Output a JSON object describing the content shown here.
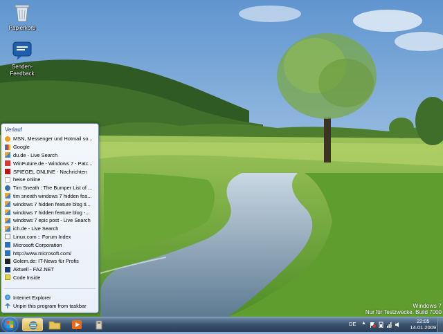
{
  "desktop": {
    "icons": [
      {
        "label": "Papierkorb",
        "icon": "recycle-bin-icon"
      },
      {
        "label": "Senden-Feedback",
        "icon": "feedback-icon"
      }
    ]
  },
  "jumplist": {
    "header": "Verlauf",
    "history": [
      {
        "label": "MSN, Messenger und Hotmail so...",
        "icon": "msn-icon"
      },
      {
        "label": "Google",
        "icon": "google-icon"
      },
      {
        "label": "du.de - Live Search",
        "icon": "live-search-icon"
      },
      {
        "label": "WinFuture.de - Windows 7 - Patc...",
        "icon": "winfuture-icon"
      },
      {
        "label": "SPIEGEL ONLINE - Nachrichten",
        "icon": "spiegel-icon"
      },
      {
        "label": "heise online",
        "icon": "heise-icon"
      },
      {
        "label": "Tim Sneath : The Bumper List of ...",
        "icon": "blog-icon"
      },
      {
        "label": "tim sneath windows 7 hidden fea...",
        "icon": "live-search-icon"
      },
      {
        "label": "windows 7 hidden feature blog ti...",
        "icon": "live-search-icon"
      },
      {
        "label": "windows 7 hidden feature blog -...",
        "icon": "live-search-icon"
      },
      {
        "label": "windows 7 epic post - Live Search",
        "icon": "live-search-icon"
      },
      {
        "label": "ich.de - Live Search",
        "icon": "live-search-icon"
      },
      {
        "label": "Linux.com :: Forum Index",
        "icon": "page-icon"
      },
      {
        "label": "Microsoft Corporation",
        "icon": "microsoft-icon"
      },
      {
        "label": "http://www.microsoft.com/",
        "icon": "microsoft-icon"
      },
      {
        "label": "Golem.de: IT-News für Profis",
        "icon": "golem-icon"
      },
      {
        "label": "Aktuell - FAZ.NET",
        "icon": "faz-icon"
      },
      {
        "label": "Code Inside",
        "icon": "codeinside-icon"
      }
    ],
    "tasks": [
      {
        "label": "Internet Explorer",
        "icon": "internet-explorer-icon"
      },
      {
        "label": "Unpin this program from taskbar",
        "icon": "unpin-icon"
      }
    ]
  },
  "watermark": {
    "line1": "Windows 7",
    "line2": "Nur für Testzwecke. Build 7000"
  },
  "taskbar": {
    "start": "start-orb-icon",
    "pinned": [
      {
        "name": "internet-explorer",
        "icon": "internet-explorer-icon",
        "active": true
      },
      {
        "name": "explorer",
        "icon": "folder-icon",
        "active": false
      },
      {
        "name": "media-player",
        "icon": "media-player-icon",
        "active": false
      },
      {
        "name": "app",
        "icon": "app-icon",
        "active": false
      }
    ],
    "tray": {
      "language": "DE",
      "time": "22:05",
      "date": "14.01.2009"
    }
  },
  "colors": {
    "jumplist_header": "#1e3f8a",
    "taskbar": "#38506b",
    "sky": "#8fb3d9",
    "grass": "#6fa83c"
  }
}
